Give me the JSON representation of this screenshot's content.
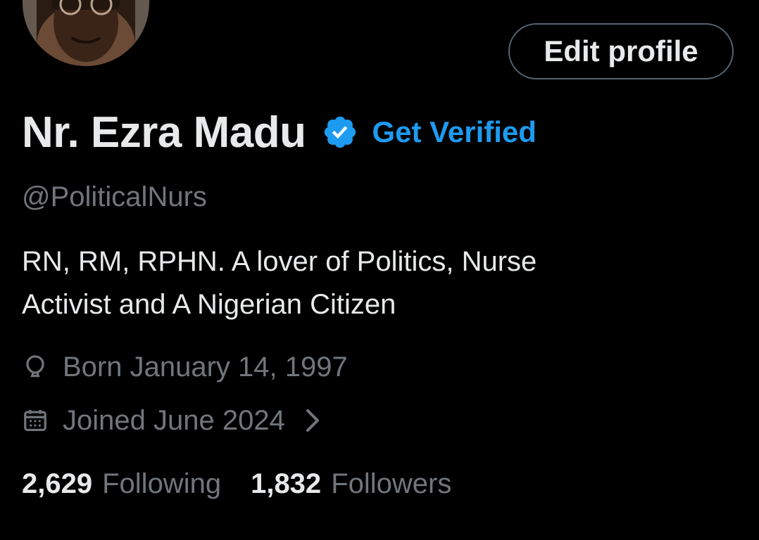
{
  "profile": {
    "display_name": "Nr. Ezra Madu",
    "get_verified_label": "Get Verified",
    "handle": "@PoliticalNurs",
    "bio": "RN, RM, RPHN. A lover of Politics,  Nurse\nActivist and A Nigerian Citizen",
    "born": "Born January 14, 1997",
    "joined": "Joined June 2024"
  },
  "actions": {
    "edit_profile_label": "Edit profile"
  },
  "stats": {
    "following_count": "2,629",
    "following_label": "Following",
    "followers_count": "1,832",
    "followers_label": "Followers"
  },
  "icons": {
    "verified": "verified-badge-icon",
    "born": "balloon-icon",
    "joined": "calendar-icon",
    "chevron": "chevron-right-icon"
  },
  "colors": {
    "background": "#000000",
    "primary_text": "#e7e9ea",
    "secondary_text": "#71767b",
    "accent": "#1d9bf0",
    "button_border": "#536471"
  }
}
